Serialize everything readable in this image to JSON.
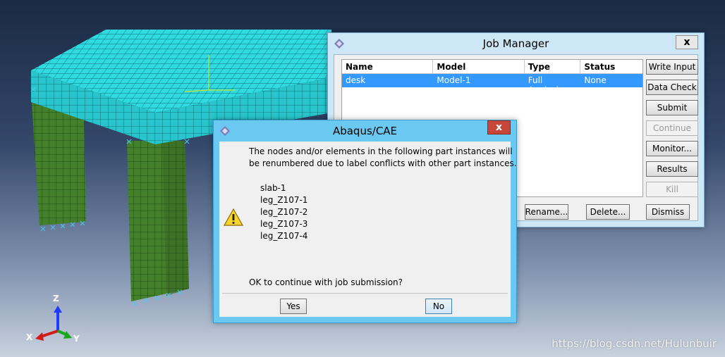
{
  "viewport": {
    "triad": {
      "z": "Z",
      "x": "X",
      "y": "Y"
    },
    "watermark": "https://blog.csdn.net/Hulunbuir"
  },
  "job_manager": {
    "title": "Job Manager",
    "close_label": "x",
    "columns": [
      "Name",
      "Model",
      "Type",
      "Status"
    ],
    "rows": [
      {
        "name": "desk",
        "model": "Model-1",
        "type": "Full Analysis",
        "status": "None"
      }
    ],
    "side_buttons": [
      "Write Input",
      "Data Check",
      "Submit",
      "Continue",
      "Monitor...",
      "Results",
      "Kill"
    ],
    "bottom_buttons": [
      "Rename...",
      "Delete...",
      "Dismiss"
    ]
  },
  "alert": {
    "title": "Abaqus/CAE",
    "close_label": "x",
    "message_line1": "The nodes and/or elements in the following part instances will",
    "message_line2": "be renumbered due to label conflicts with other part instances.",
    "parts": [
      "slab-1",
      "leg_Z107-1",
      "leg_Z107-2",
      "leg_Z107-3",
      "leg_Z107-4"
    ],
    "question": "OK to continue with job submission?",
    "yes_label": "Yes",
    "no_label": "No",
    "icon": "warning-icon"
  },
  "colors": {
    "slab": "#29d6d9",
    "leg": "#3f7a2a",
    "selection": "#3399ff",
    "alert_frame": "#6bc8f0",
    "close_red": "#c7463a"
  }
}
